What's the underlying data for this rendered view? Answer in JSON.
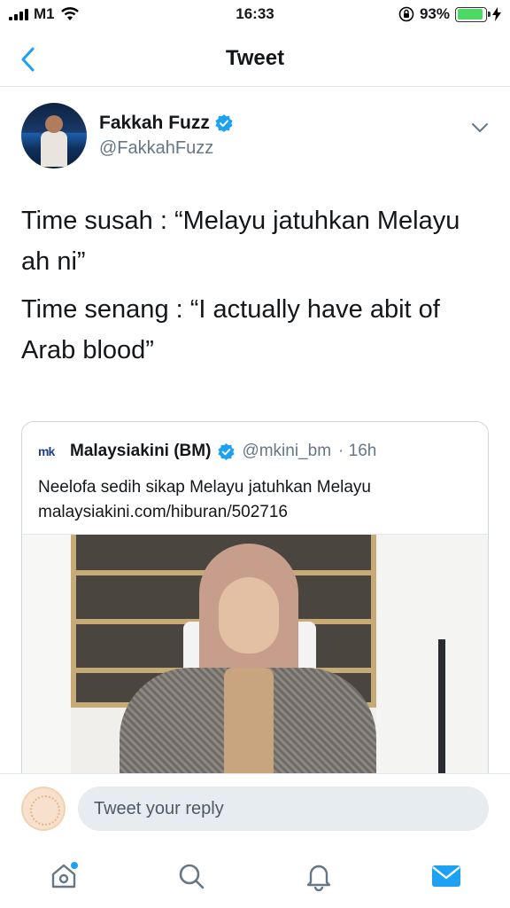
{
  "status_bar": {
    "carrier": "M1",
    "time": "16:33",
    "battery_percent": "93%",
    "battery_level": 0.93
  },
  "nav": {
    "title": "Tweet"
  },
  "tweet": {
    "display_name": "Fakkah Fuzz",
    "handle": "@FakkahFuzz",
    "verified": true,
    "text_lines": [
      "Time susah : “Melayu jatuhkan Melayu ah ni”",
      "Time senang : “I actually have abit of Arab blood”"
    ]
  },
  "quote": {
    "name": "Malaysiakini (BM)",
    "handle": "@mkini_bm",
    "time": "· 16h",
    "logo_text": "mk",
    "text": "Neelofa sedih sikap Melayu jatuhkan Melayu",
    "link": "malaysiakini.com/hiburan/502716"
  },
  "reply": {
    "placeholder": "Tweet your reply"
  },
  "tabs": [
    "home-icon",
    "search-icon",
    "notifications-icon",
    "messages-icon"
  ],
  "colors": {
    "accent": "#1da1f2",
    "verified": "#1da1f2",
    "battery": "#4cd964"
  }
}
